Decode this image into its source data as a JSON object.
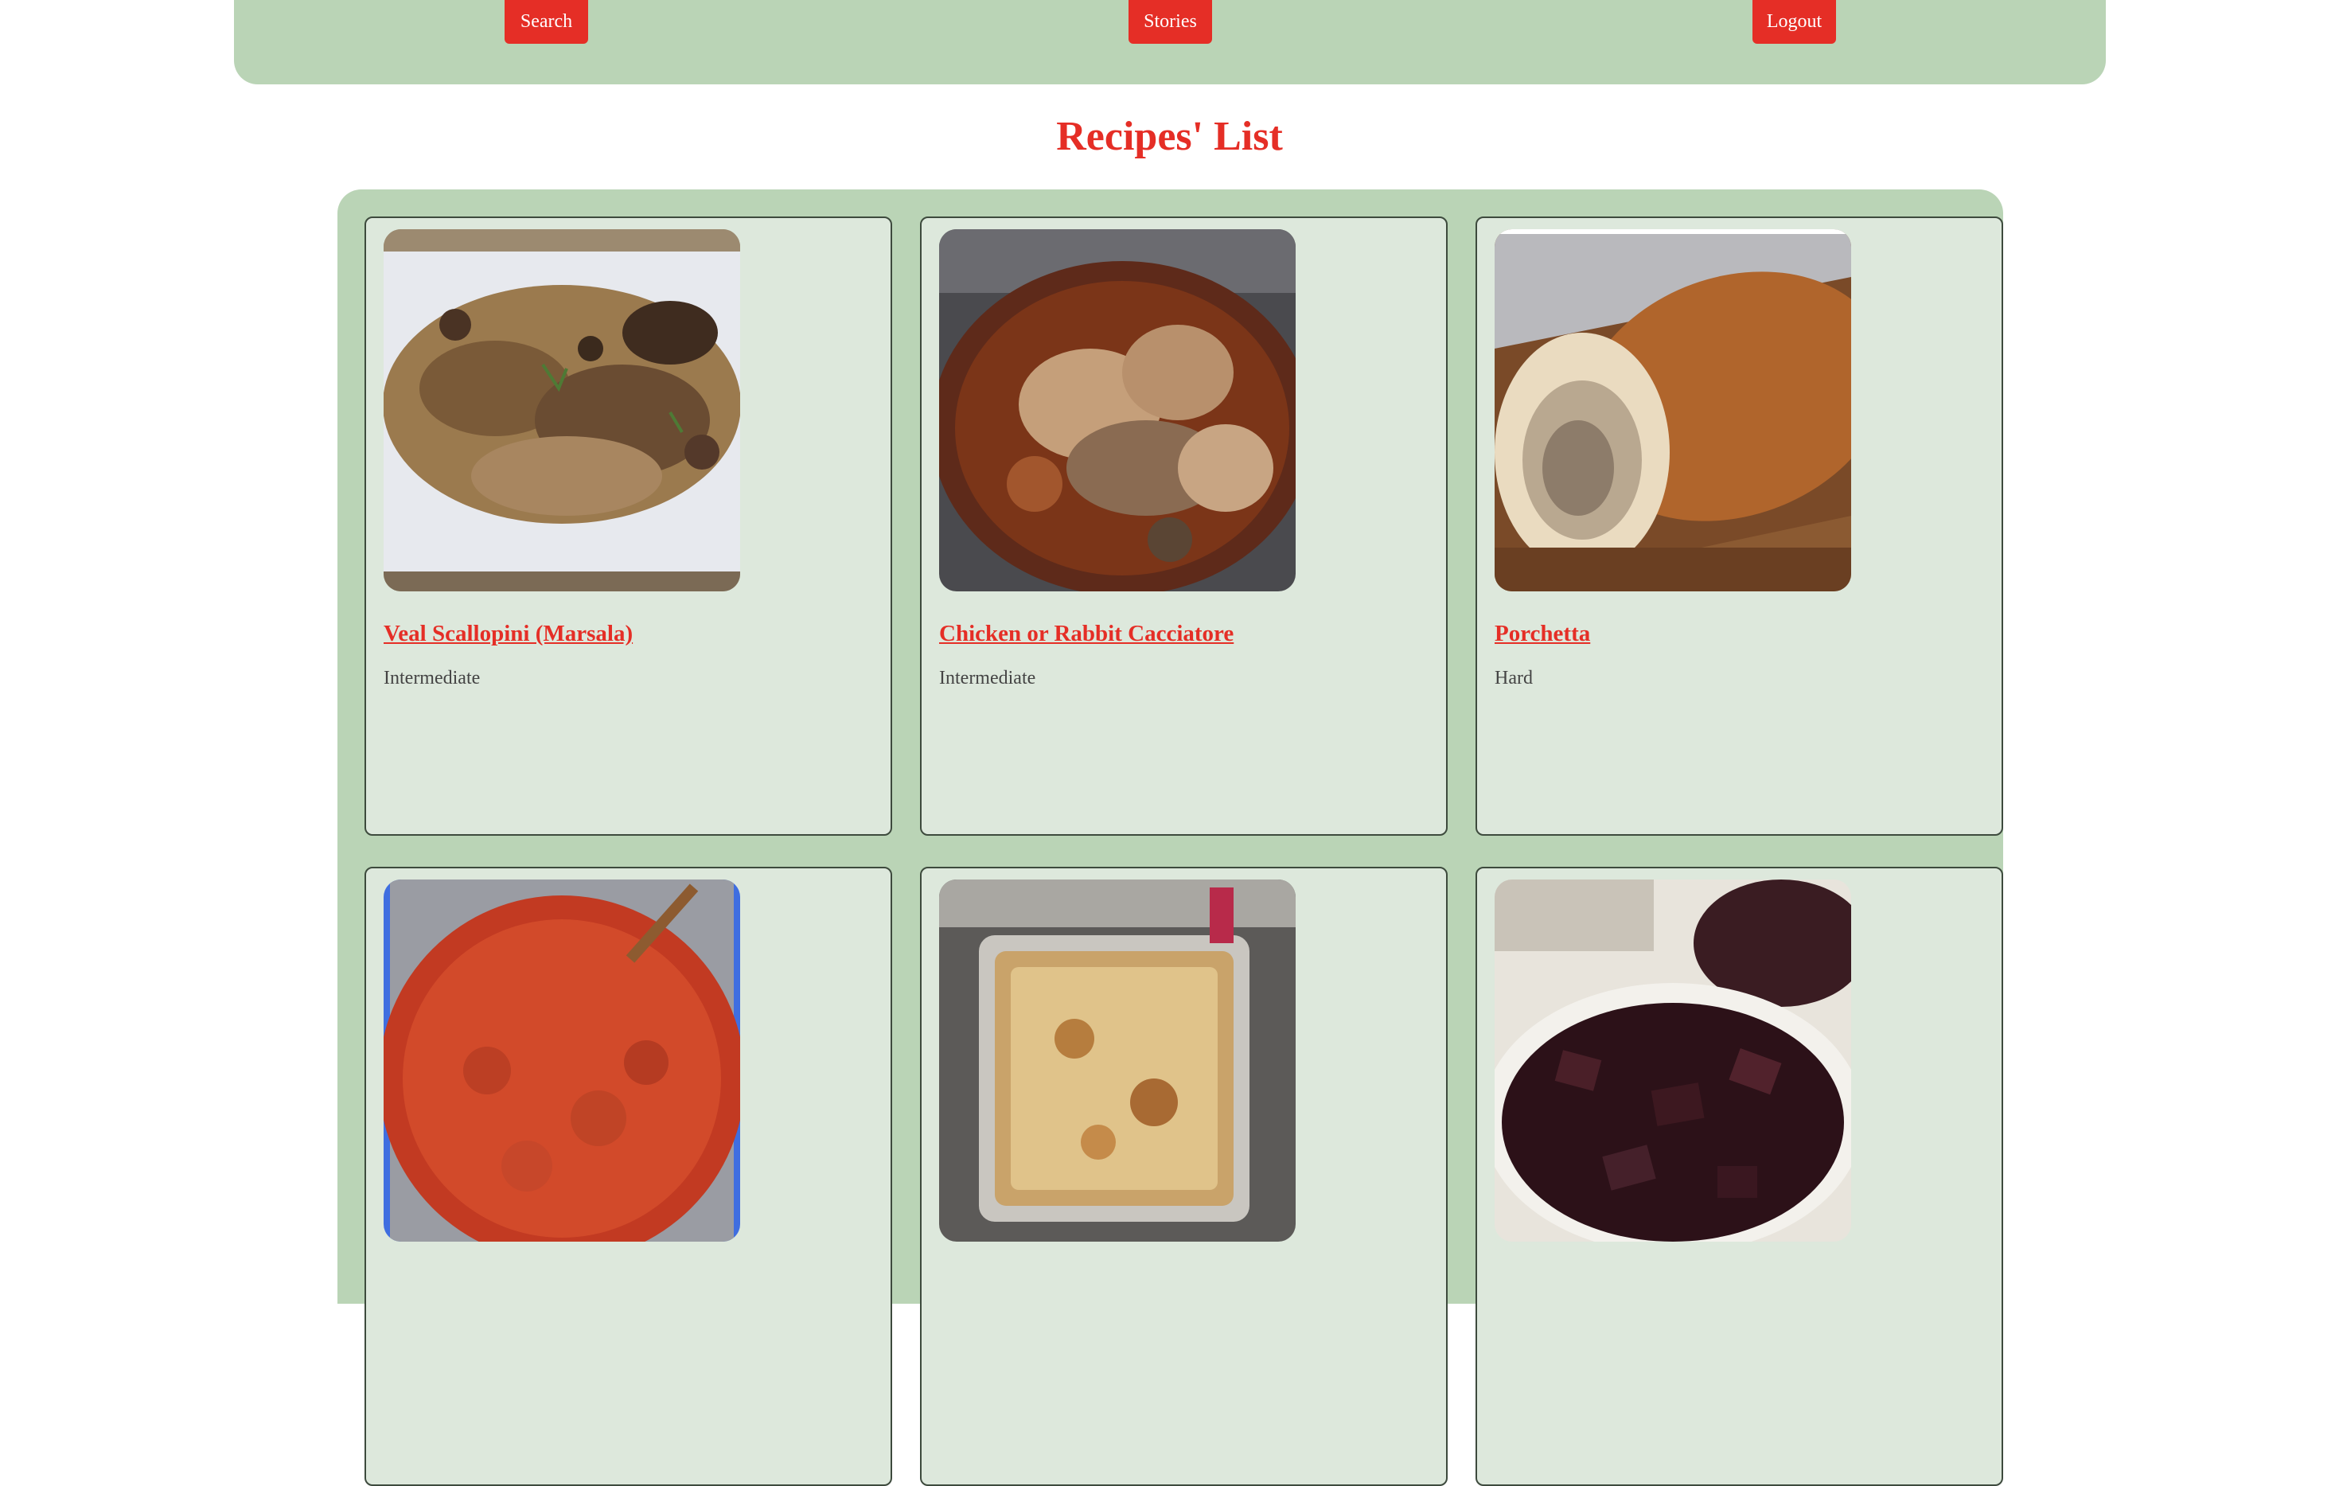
{
  "nav": {
    "search_label": "Search",
    "stories_label": "Stories",
    "logout_label": "Logout"
  },
  "page_title": "Recipes' List",
  "recipes": [
    {
      "title": "Veal Scallopini (Marsala)",
      "difficulty": "Intermediate",
      "image": "veal-scallopini-photo"
    },
    {
      "title": "Chicken or Rabbit Cacciatore",
      "difficulty": "Intermediate",
      "image": "chicken-cacciatore-photo"
    },
    {
      "title": "Porchetta",
      "difficulty": "Hard",
      "image": "porchetta-photo"
    },
    {
      "title": "",
      "difficulty": "",
      "image": "tomato-sauce-meatballs-photo"
    },
    {
      "title": "",
      "difficulty": "",
      "image": "lasagna-photo"
    },
    {
      "title": "",
      "difficulty": "",
      "image": "burnt-ends-photo"
    }
  ],
  "colors": {
    "accent": "#e52e26",
    "panel": "#bad4b6",
    "card": "#dde8dc"
  }
}
